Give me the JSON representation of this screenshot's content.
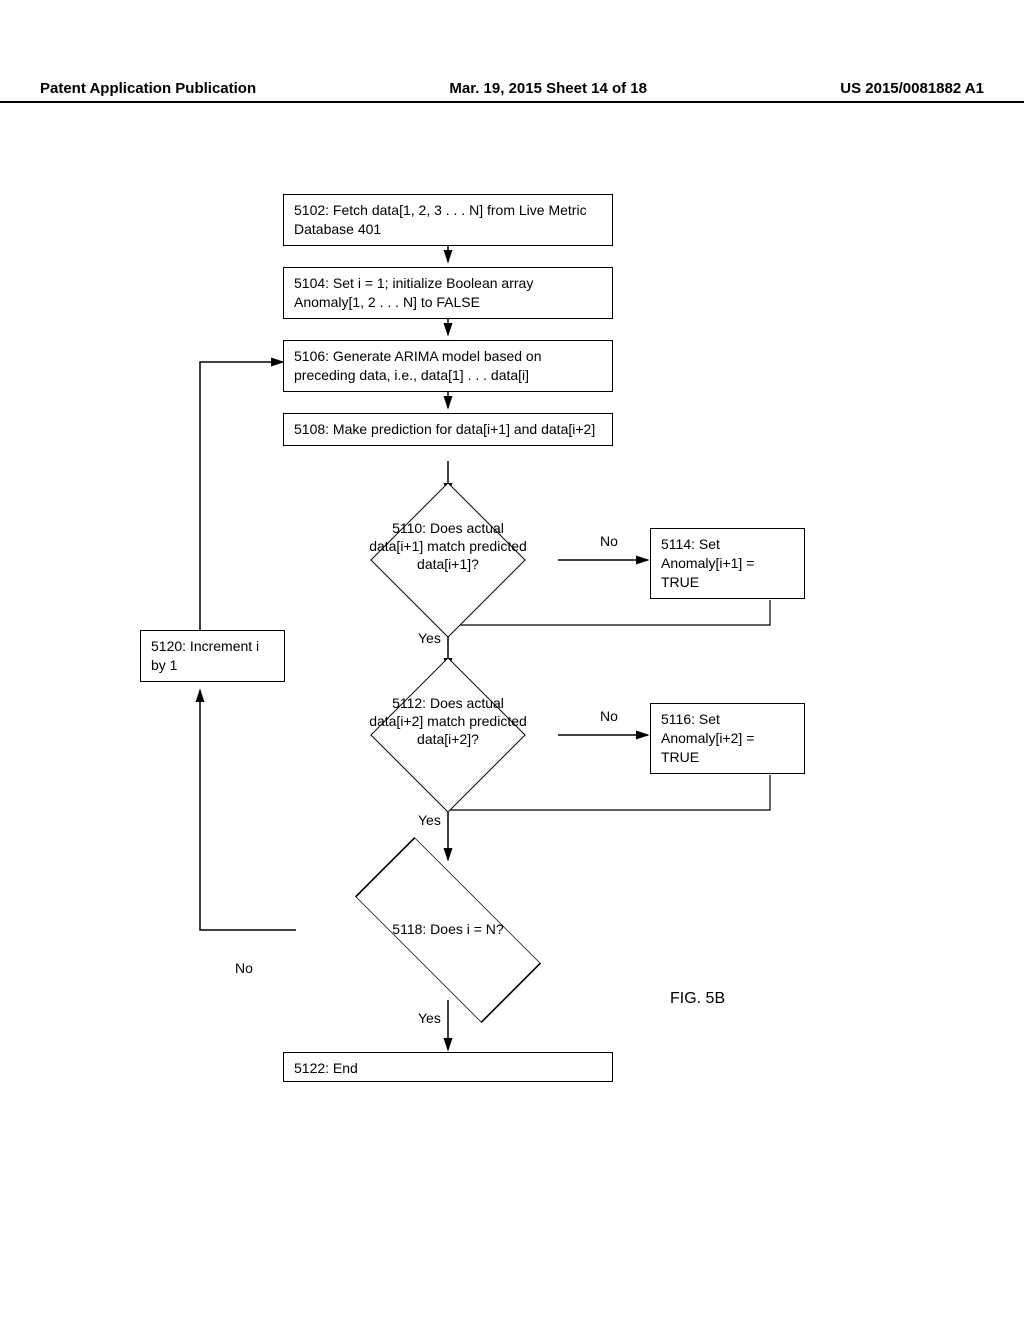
{
  "header": {
    "left": "Patent Application Publication",
    "center": "Mar. 19, 2015  Sheet 14 of 18",
    "right": "US 2015/0081882 A1"
  },
  "boxes": {
    "b5102": "5102: Fetch data[1, 2, 3 . . . N] from Live Metric Database 401",
    "b5104": "5104: Set i = 1; initialize Boolean array Anomaly[1, 2 . . . N] to FALSE",
    "b5106": "5106: Generate ARIMA model based on preceding data, i.e., data[1] . . . data[i]",
    "b5108": "5108: Make prediction for data[i+1] and data[i+2]",
    "b5114": "5114: Set Anomaly[i+1] = TRUE",
    "b5116": "5116: Set Anomaly[i+2] = TRUE",
    "b5120": "5120: Increment i by 1",
    "b5122": "5122: End"
  },
  "diamonds": {
    "d5110": "5110: Does actual data[i+1] match predicted data[i+1]?",
    "d5112": "5112: Does actual data[i+2] match predicted data[i+2]?",
    "d5118": "5118: Does i = N?"
  },
  "labels": {
    "no": "No",
    "yes": "Yes"
  },
  "figure": "FIG. 5B"
}
